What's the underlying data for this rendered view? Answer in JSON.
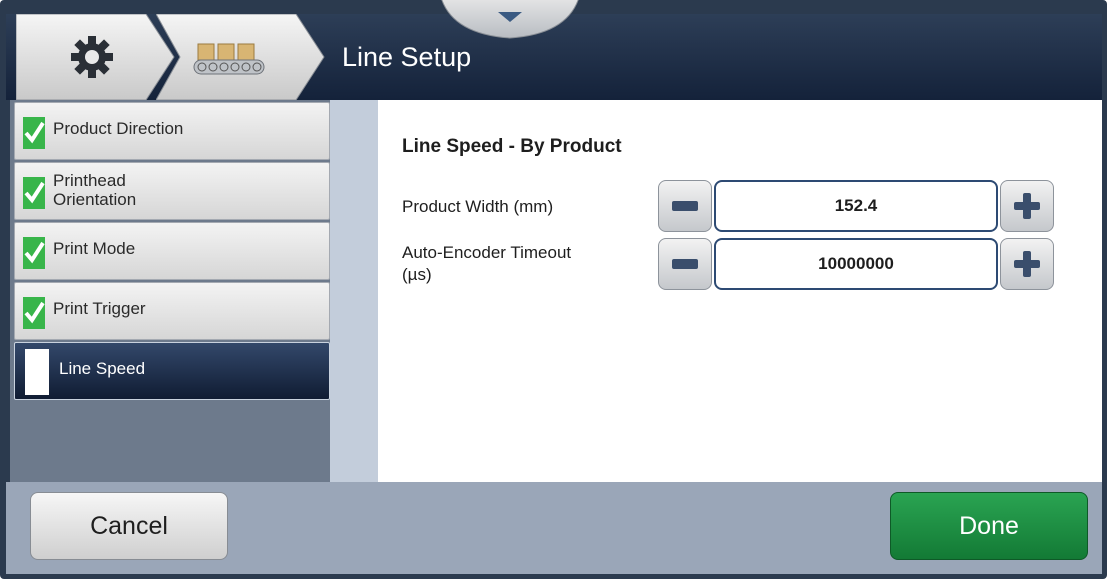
{
  "header": {
    "title": "Line Setup",
    "breadcrumb_icons": [
      "gear-icon",
      "conveyor-icon"
    ],
    "menu_tab_icon": "chevron-down-icon"
  },
  "sidebar": {
    "items": [
      {
        "label": "Product Direction",
        "complete": true
      },
      {
        "label": "Printhead Orientation",
        "line1": "Printhead",
        "line2": "Orientation",
        "complete": true
      },
      {
        "label": "Print Mode",
        "complete": true
      },
      {
        "label": "Print Trigger",
        "complete": true
      },
      {
        "label": "Line Speed",
        "complete": false,
        "active": true
      }
    ]
  },
  "main": {
    "section_title": "Line Speed - By Product",
    "fields": [
      {
        "label": "Product Width (mm)",
        "value": "152.4"
      },
      {
        "label": "Auto-Encoder Timeout (µs)",
        "line1": "Auto-Encoder Timeout",
        "line2": "(µs)",
        "value": "10000000"
      }
    ]
  },
  "footer": {
    "cancel_label": "Cancel",
    "done_label": "Done"
  },
  "colors": {
    "header_bg": "#1b2a44",
    "accent_green": "#1f8f44",
    "check_green": "#38b54a"
  }
}
